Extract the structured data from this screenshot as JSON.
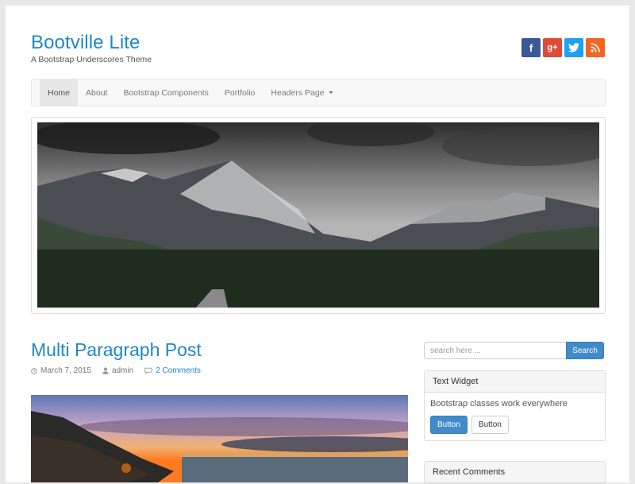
{
  "site": {
    "title": "Bootville Lite",
    "description": "A Bootstrap Underscores Theme"
  },
  "social": [
    {
      "icon": "facebook-icon",
      "glyph": "f",
      "color": "#3b5998"
    },
    {
      "icon": "google-plus-icon",
      "glyph": "g+",
      "color": "#dd4b39"
    },
    {
      "icon": "twitter-icon",
      "glyph": "t",
      "color": "#1da1f2"
    },
    {
      "icon": "rss-icon",
      "glyph": "rss",
      "color": "#f26522"
    }
  ],
  "nav": {
    "items": [
      {
        "label": "Home",
        "active": true
      },
      {
        "label": "About"
      },
      {
        "label": "Bootstrap Components"
      },
      {
        "label": "Portfolio"
      },
      {
        "label": "Headers Page",
        "dropdown": true
      }
    ]
  },
  "post": {
    "title": "Multi Paragraph Post",
    "date": "March 7, 2015",
    "author": "admin",
    "comments": "2 Comments"
  },
  "sidebar": {
    "search_placeholder": "search here ...",
    "search_button": "Search",
    "text_widget": {
      "title": "Text Widget",
      "body": "Bootstrap classes work everywhere",
      "primary_button": "Button",
      "default_button": "Button"
    },
    "recent_comments_title": "Recent Comments"
  },
  "colors": {
    "link": "#1e88c8",
    "primary": "#428bca"
  }
}
